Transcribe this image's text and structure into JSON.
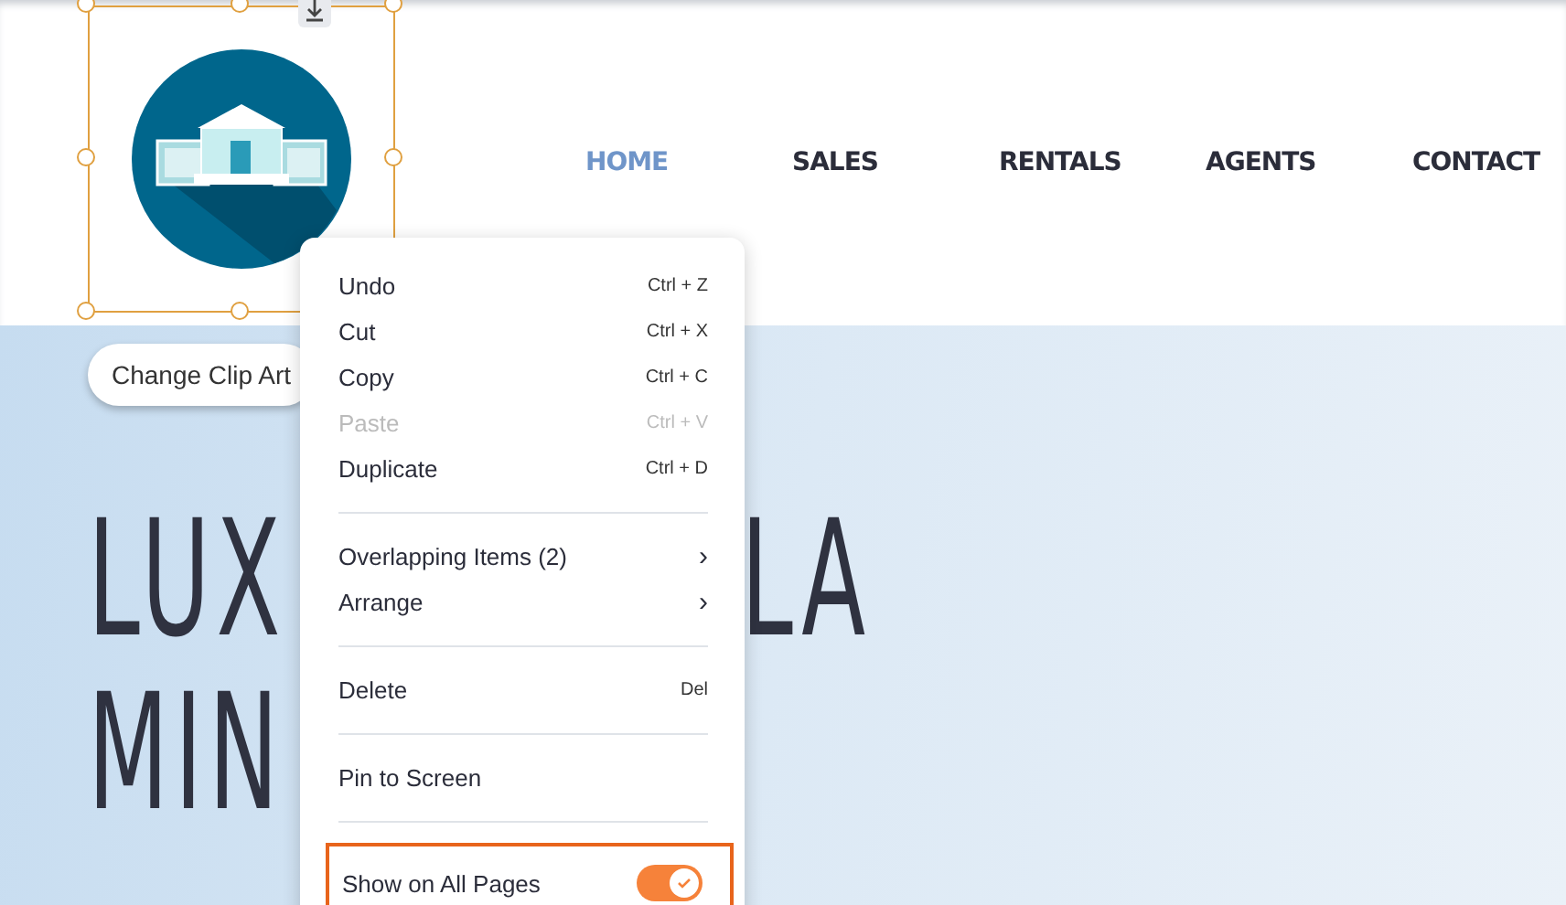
{
  "header": {
    "logo": {
      "selected": true
    },
    "nav": [
      {
        "label": "HOME",
        "selected": true
      },
      {
        "label": "SALES",
        "selected": false
      },
      {
        "label": "RENTALS",
        "selected": false
      },
      {
        "label": "AGENTS",
        "selected": false
      },
      {
        "label": "CONTACT",
        "selected": false
      }
    ]
  },
  "clip_art_button": "Change Clip Art",
  "hero": {
    "lines": [
      {
        "left": "LUX",
        "right": "LA"
      },
      {
        "left": "MIN"
      }
    ]
  },
  "context_menu": {
    "items": [
      {
        "kind": "action",
        "label": "Undo",
        "shortcut": "Ctrl + Z",
        "disabled": false
      },
      {
        "kind": "action",
        "label": "Cut",
        "shortcut": "Ctrl + X",
        "disabled": false
      },
      {
        "kind": "action",
        "label": "Copy",
        "shortcut": "Ctrl + C",
        "disabled": false
      },
      {
        "kind": "action",
        "label": "Paste",
        "shortcut": "Ctrl + V",
        "disabled": true
      },
      {
        "kind": "action",
        "label": "Duplicate",
        "shortcut": "Ctrl + D",
        "disabled": false
      },
      {
        "kind": "divider"
      },
      {
        "kind": "submenu",
        "label": "Overlapping Items (2)",
        "chevron": "›"
      },
      {
        "kind": "submenu",
        "label": "Arrange",
        "chevron": "›"
      },
      {
        "kind": "divider"
      },
      {
        "kind": "action",
        "label": "Delete",
        "shortcut": "Del",
        "disabled": false
      },
      {
        "kind": "divider"
      },
      {
        "kind": "action",
        "label": "Pin to Screen",
        "disabled": false
      },
      {
        "kind": "divider"
      },
      {
        "kind": "toggle",
        "label": "Show on All Pages",
        "on": true,
        "highlighted": true
      }
    ]
  }
}
